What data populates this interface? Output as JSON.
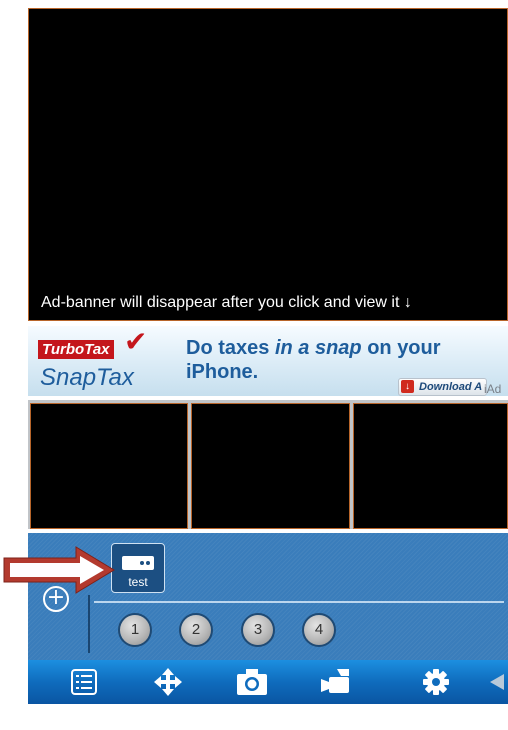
{
  "main_view": {
    "ad_notice": "Ad-banner will disappear after you click and view it ↓"
  },
  "ad_banner": {
    "brand_top": "TurboTax",
    "brand_bottom": "SnapTax",
    "headline_part1": "Do taxes ",
    "headline_emphasis": "in a snap",
    "headline_part2": " on your iPhone.",
    "download_label": "Download A",
    "iad_label": "iAd",
    "colors": {
      "brand_red": "#c4161c",
      "brand_blue": "#1e5d9c"
    }
  },
  "camera_grid": {
    "cells": [
      "cell-1",
      "cell-2",
      "cell-3"
    ]
  },
  "control_panel": {
    "add_symbol": "+",
    "group": {
      "label": "test",
      "icon": "dvr-icon"
    },
    "camera_numbers": [
      "1",
      "2",
      "3",
      "4"
    ],
    "colors": {
      "panel": "#3a7dbb",
      "highlight_arrow": "#b33a2e"
    }
  },
  "toolbar": {
    "items": [
      {
        "icon": "list-icon"
      },
      {
        "icon": "move-icon"
      },
      {
        "icon": "camera-icon"
      },
      {
        "icon": "record-icon"
      },
      {
        "icon": "gear-icon"
      }
    ],
    "color": "#0f6cbd"
  }
}
